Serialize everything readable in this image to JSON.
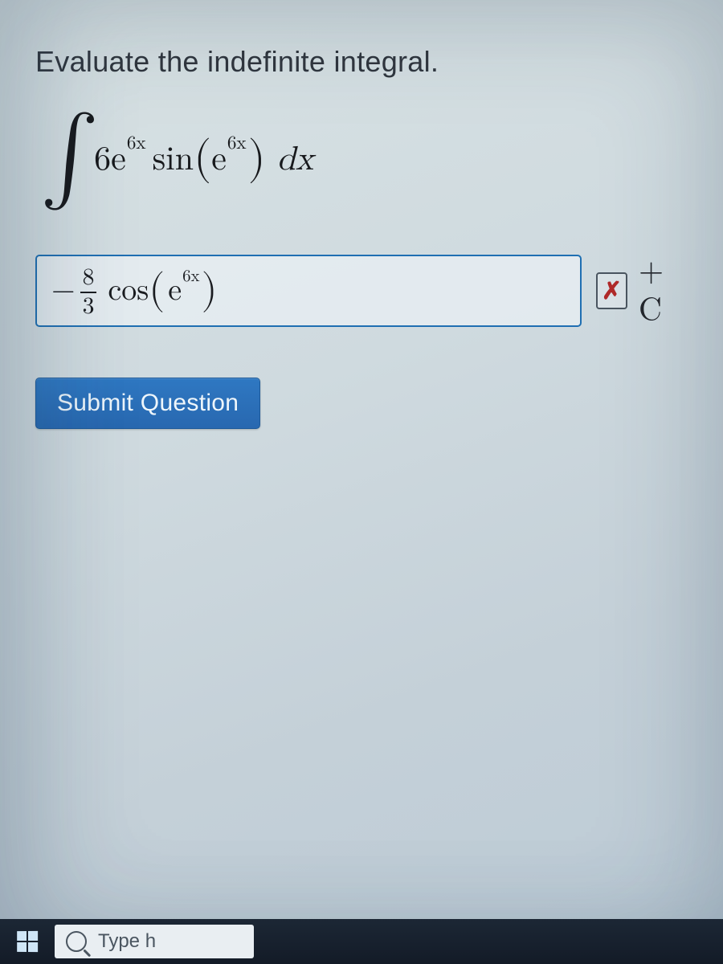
{
  "question": {
    "prompt": "Evaluate the indefinite integral.",
    "integral": {
      "coeff": "6",
      "base1": "e",
      "exp1": "6x",
      "func": "sin",
      "inner_base": "e",
      "inner_exp": "6x",
      "differential": "dx"
    }
  },
  "answer": {
    "leading_sign": "−",
    "frac_num": "8",
    "frac_den": "3",
    "func": "cos",
    "inner_base": "e",
    "inner_exp": "6x",
    "status": "incorrect",
    "status_glyph": "✗",
    "constant": "+ C"
  },
  "actions": {
    "submit_label": "Submit Question"
  },
  "taskbar": {
    "search_placeholder": "Type h"
  }
}
